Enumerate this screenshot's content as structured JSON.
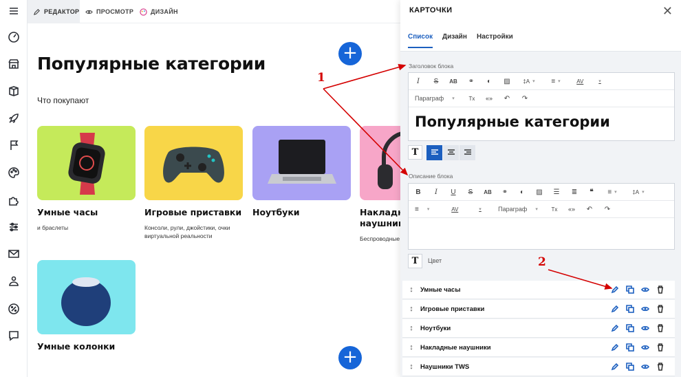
{
  "topbar": {
    "tabs": [
      "РЕДАКТОР",
      "ПРОСМОТР",
      "ДИЗАЙН"
    ]
  },
  "sidebar": {
    "icons": [
      "menu-icon",
      "dashboard-icon",
      "store-icon",
      "box-icon",
      "rocket-icon",
      "flag-icon",
      "palette-icon",
      "puzzle-icon",
      "sliders-icon",
      "mail-icon",
      "users-icon",
      "percent-icon",
      "chat-icon"
    ]
  },
  "main": {
    "title": "Популярные категории",
    "subtitle": "Что покупают",
    "cards": [
      {
        "title": "Умные часы",
        "desc": "и браслеты",
        "bg": "#c5ea5a"
      },
      {
        "title": "Игровые приставки",
        "desc": "Консоли, рули, джойстики, очки виртуальной реальности",
        "bg": "#f8d648"
      },
      {
        "title": "Ноутбуки",
        "desc": "",
        "bg": "#a9a1f4"
      },
      {
        "title": "Накладные наушники",
        "desc": "Беспроводные с",
        "bg": "#f7a6c8"
      },
      {
        "title": "Умные колонки",
        "desc": "",
        "bg": "#7ee6ee"
      }
    ],
    "plus": "+"
  },
  "panel": {
    "title": "КАРТОЧКИ",
    "close": "✕",
    "tabs": [
      "Список",
      "Дизайн",
      "Настройки"
    ],
    "heading_label": "Заголовок блока",
    "heading_value": "Популярные категории",
    "desc_label": "Описание блока",
    "paragraph": "Параграф",
    "color_label": "Цвет",
    "tb": {
      "ab": "AB",
      "ia": "‡A",
      "av": "AV",
      "tx": "Tx",
      "quote": "«»"
    },
    "items": [
      "Умные часы",
      "Игровые приставки",
      "Ноутбуки",
      "Накладные наушники",
      "Наушники TWS"
    ]
  },
  "annotations": {
    "a1": "1",
    "a2": "2"
  },
  "colors": {
    "accent": "#1c5fbf",
    "plus": "#1665d8",
    "arrow": "#d40000"
  }
}
